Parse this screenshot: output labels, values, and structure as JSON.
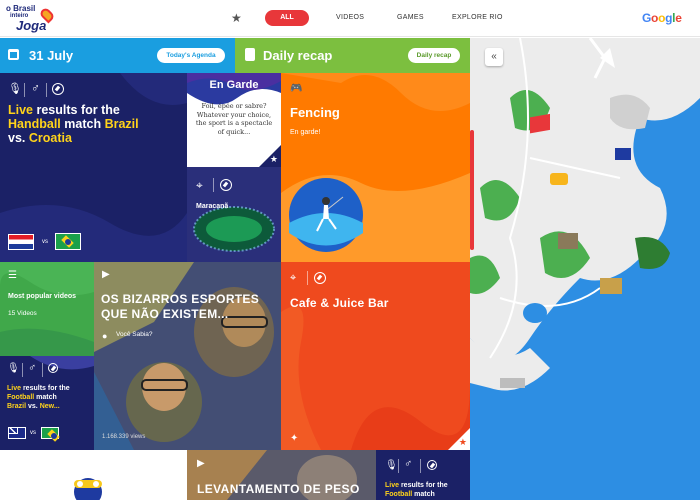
{
  "logo": {
    "line1": "o Brasil",
    "line2": "inteiro",
    "line3": "Joga"
  },
  "nav": {
    "all": "ALL",
    "videos": "VIDEOS",
    "games": "GAMES",
    "explore": "EXPLORE RIO",
    "google": [
      "G",
      "o",
      "o",
      "g",
      "l",
      "e"
    ]
  },
  "agenda": {
    "date": "31 July",
    "button": "Today's Agenda"
  },
  "recap": {
    "title": "Daily recap",
    "button": "Daily recap"
  },
  "handball": {
    "w1": "Live",
    "w2": " results for the",
    "w3": "Handball",
    "w4": " match ",
    "w5": "Brazil",
    "w6": "vs. ",
    "w7": "Croatia",
    "vs": "vs"
  },
  "engarde": {
    "title": "En Garde",
    "text": "Foil, épée or sabre? Whatever your choice, the sport is a spectacle of quick..."
  },
  "maracana": {
    "label": "Maracanã"
  },
  "fencing": {
    "title": "Fencing",
    "subtitle": "En garde!"
  },
  "popular": {
    "title": "Most popular videos",
    "count": "15 Videos"
  },
  "football": {
    "w1": "Live",
    "w2": " results for the",
    "w3": "Football",
    "w4": " match",
    "w5": "Brazil",
    "w6": " vs. ",
    "w7": "New...",
    "vs": "vs"
  },
  "bizarros": {
    "title": "OS BIZARROS ESPORTES QUE NÃO EXISTEM...",
    "sub": "Você Sabia?",
    "views": "1.168.339 views"
  },
  "cafe": {
    "title": "Cafe & Juice Bar"
  },
  "bottom": {
    "video_title": "LEVANTAMENTO DE PESO",
    "w1": "Live",
    "w2": " results for the",
    "w3": "Football",
    "w4": " match"
  },
  "colors": {
    "accent": "#e8373a",
    "blue": "#1a9ee0",
    "green": "#7cbf3f",
    "orange": "#ff7a00",
    "red": "#ef4a1e",
    "navy": "#1b2166",
    "yellow": "#ffd31a",
    "water": "#2d8ee3"
  },
  "icons": {
    "collapse": "«",
    "star": "★",
    "play": "▶"
  }
}
